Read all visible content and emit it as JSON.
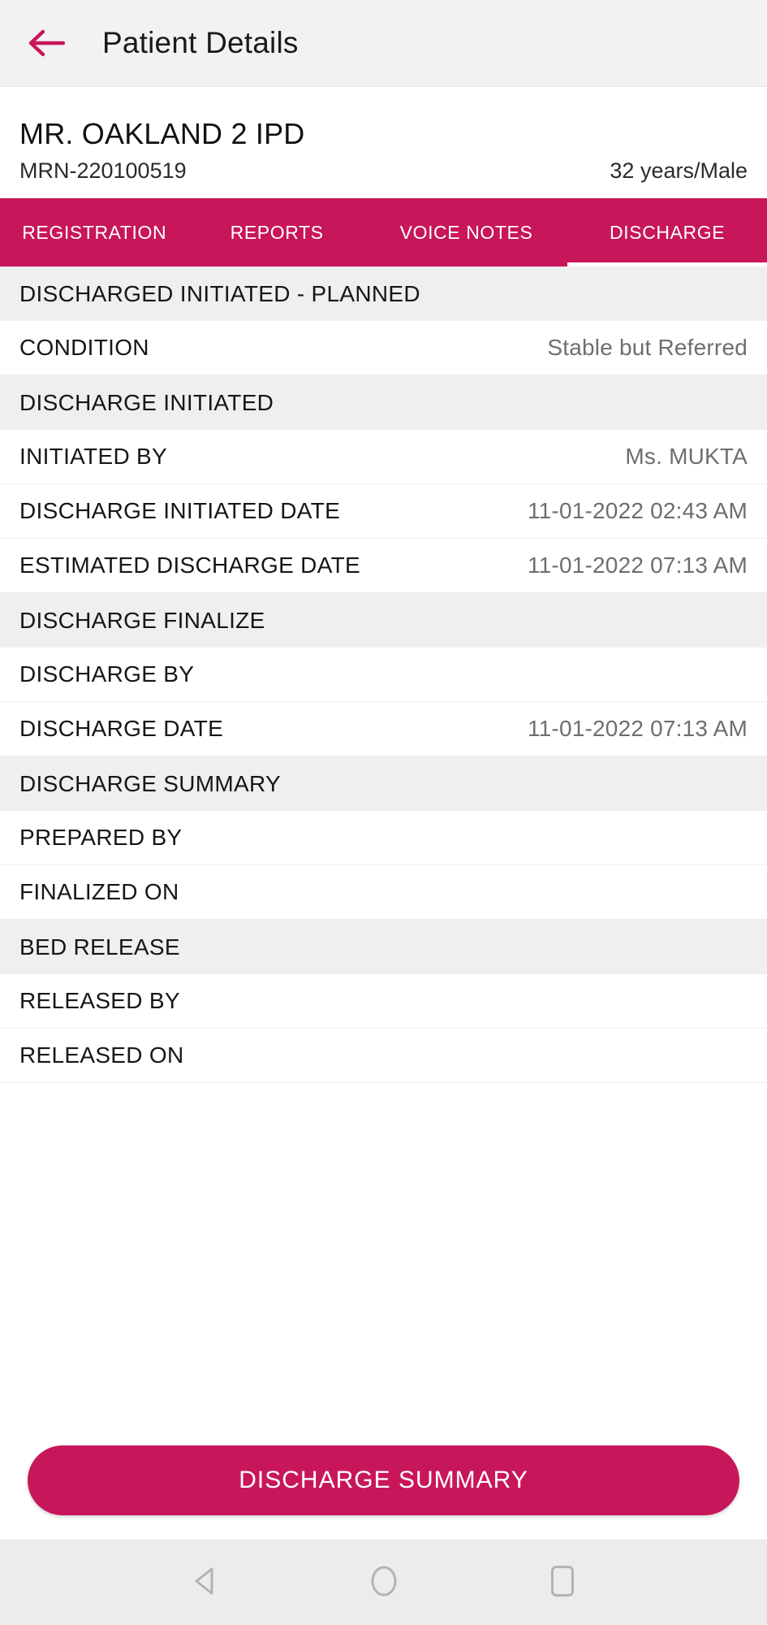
{
  "appbar": {
    "title": "Patient Details",
    "back_icon": "arrow-left-icon"
  },
  "patient": {
    "name": "MR. OAKLAND 2 IPD",
    "mrn": "MRN-220100519",
    "demographics": "32 years/Male"
  },
  "tabs": [
    {
      "label": "REGISTRATION",
      "active": false
    },
    {
      "label": "REPORTS",
      "active": false
    },
    {
      "label": "VOICE NOTES",
      "active": false
    },
    {
      "label": "DISCHARGE",
      "active": true
    }
  ],
  "sections": [
    {
      "header": "DISCHARGED INITIATED - PLANNED",
      "rows": [
        {
          "label": "CONDITION",
          "value": "Stable but Referred"
        }
      ]
    },
    {
      "header": "DISCHARGE INITIATED",
      "rows": [
        {
          "label": "INITIATED BY",
          "value": "Ms. MUKTA"
        },
        {
          "label": "DISCHARGE INITIATED DATE",
          "value": "11-01-2022 02:43 AM"
        },
        {
          "label": "ESTIMATED DISCHARGE DATE",
          "value": "11-01-2022 07:13 AM"
        }
      ]
    },
    {
      "header": "DISCHARGE FINALIZE",
      "rows": [
        {
          "label": "DISCHARGE BY",
          "value": ""
        },
        {
          "label": "DISCHARGE DATE",
          "value": "11-01-2022 07:13 AM"
        }
      ]
    },
    {
      "header": "DISCHARGE SUMMARY",
      "rows": [
        {
          "label": "PREPARED BY",
          "value": ""
        },
        {
          "label": "FINALIZED ON",
          "value": ""
        }
      ]
    },
    {
      "header": "BED RELEASE",
      "rows": [
        {
          "label": "RELEASED BY",
          "value": ""
        },
        {
          "label": "RELEASED ON",
          "value": ""
        }
      ]
    }
  ],
  "action": {
    "label": "DISCHARGE SUMMARY"
  },
  "navbar": {
    "back_icon": "triangle-back-icon",
    "home_icon": "circle-home-icon",
    "recents_icon": "square-recents-icon"
  },
  "colors": {
    "brand": "#c8165a",
    "section_bg": "#efefef",
    "appbar_bg": "#f2f2f2",
    "value_text": "#6e6e6e",
    "navbar_bg": "#ececec"
  }
}
